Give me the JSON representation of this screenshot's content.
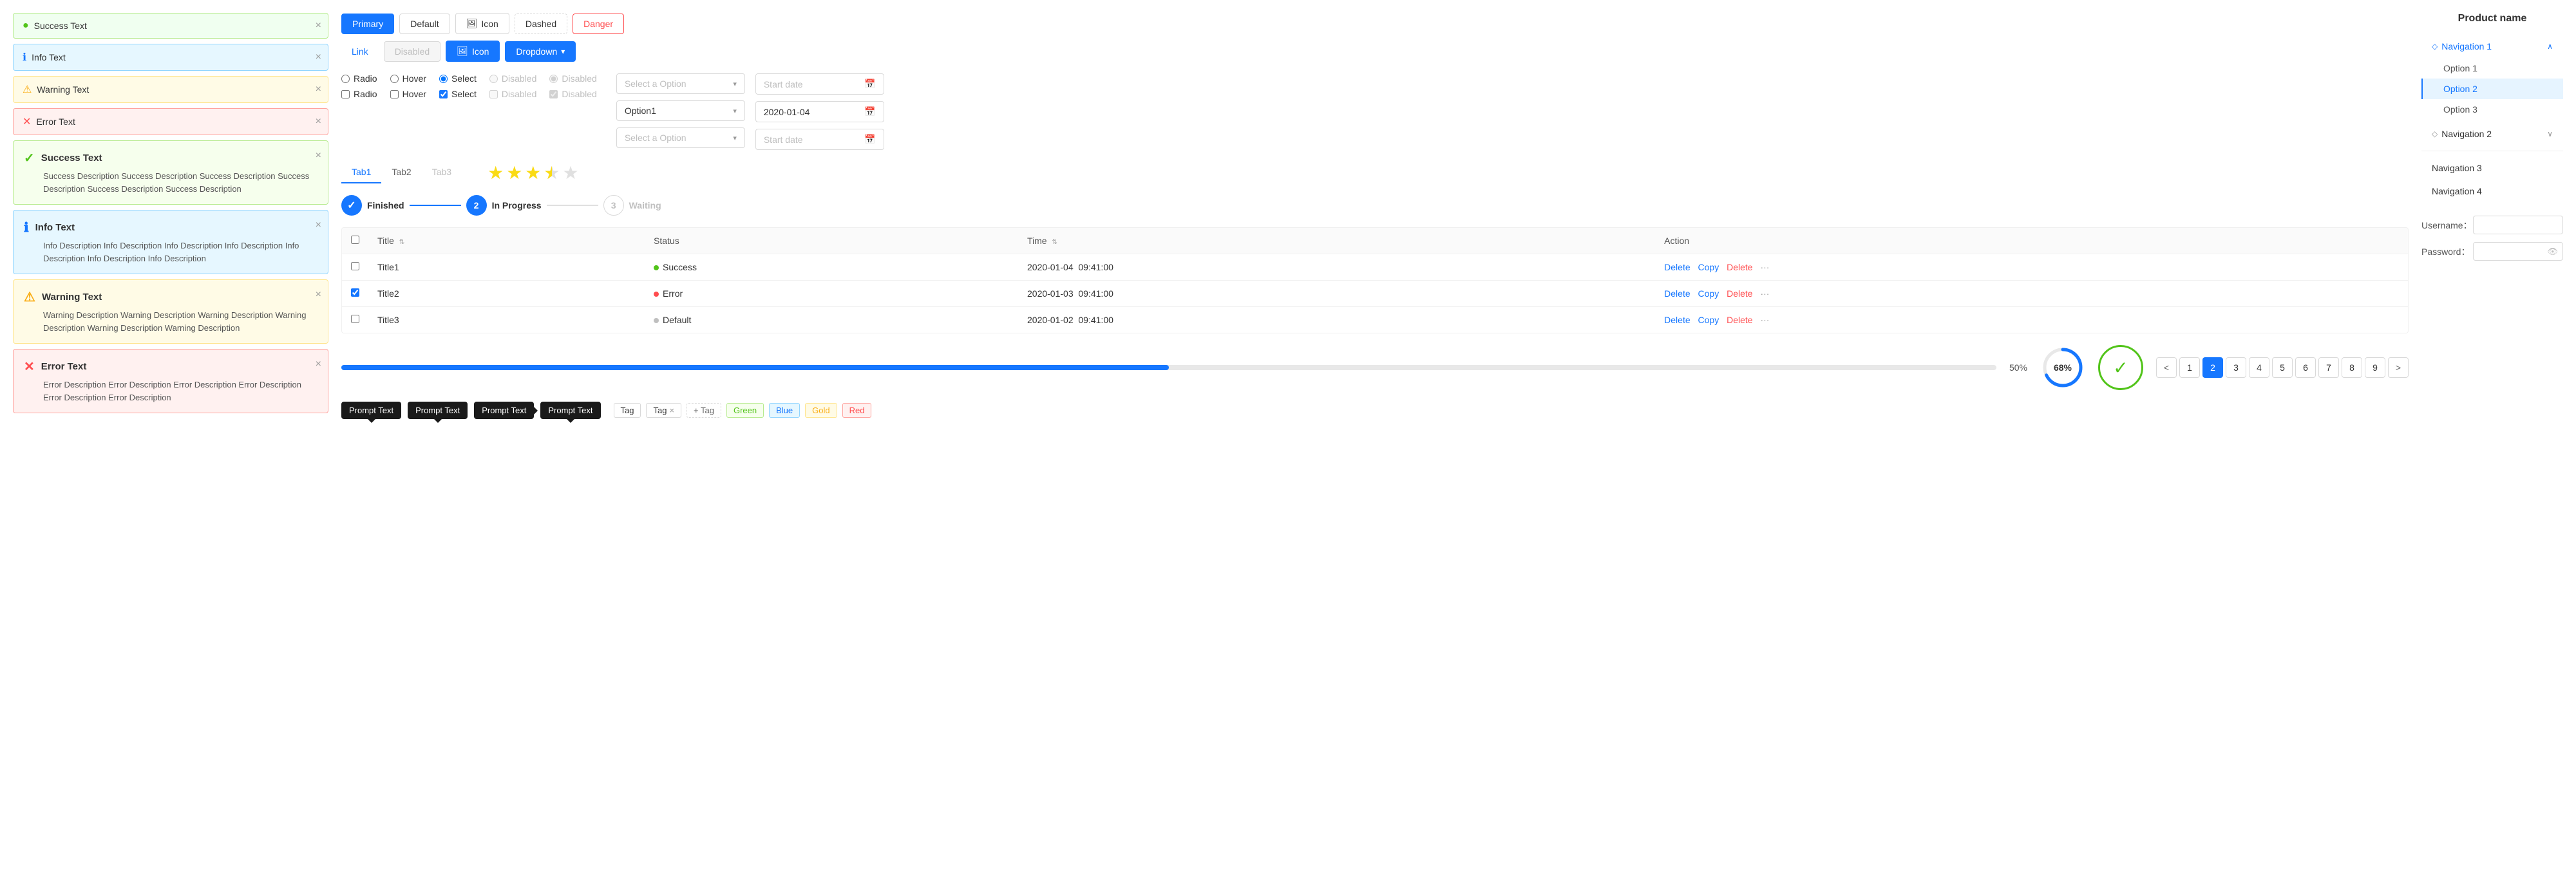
{
  "leftPanel": {
    "simpleAlerts": [
      {
        "type": "success",
        "icon": "●",
        "text": "Success Text",
        "iconColor": "#52c41a"
      },
      {
        "type": "info",
        "icon": "ℹ",
        "text": "Info Text",
        "iconColor": "#1677ff"
      },
      {
        "type": "warning",
        "icon": "⚠",
        "text": "Warning Text",
        "iconColor": "#faad14"
      },
      {
        "type": "error",
        "icon": "✕",
        "text": "Error Text",
        "iconColor": "#ff4d4f"
      }
    ],
    "complexAlerts": [
      {
        "type": "success",
        "icon": "✓",
        "title": "Success Text",
        "desc": "Success Description Success Description Success Description Success Description Success Description Success Description",
        "iconColor": "#52c41a"
      },
      {
        "type": "info",
        "icon": "ℹ",
        "title": "Info Text",
        "desc": "Info Description Info Description Info Description Info Description Info Description Info Description Info Description",
        "iconColor": "#1677ff"
      },
      {
        "type": "warning",
        "icon": "⚠",
        "title": "Warning Text",
        "desc": "Warning Description Warning Description Warning Description Warning Description Warning Description Warning Description",
        "iconColor": "#faad14"
      },
      {
        "type": "error",
        "icon": "✕",
        "title": "Error Text",
        "desc": "Error Description Error Description Error Description Error Description Error Description Error Description",
        "iconColor": "#ff4d4f"
      }
    ]
  },
  "buttons": {
    "row1": [
      {
        "label": "Primary",
        "style": "primary"
      },
      {
        "label": "Default",
        "style": "default"
      },
      {
        "label": "Icon",
        "style": "icon",
        "hasIcon": true
      },
      {
        "label": "Dashed",
        "style": "dashed"
      },
      {
        "label": "Danger",
        "style": "danger"
      }
    ],
    "row2": [
      {
        "label": "Link",
        "style": "link"
      },
      {
        "label": "Disabled",
        "style": "disabled"
      },
      {
        "label": "Icon",
        "style": "icon-blue",
        "hasIcon": true
      },
      {
        "label": "Dropdown",
        "style": "dropdown",
        "hasArrow": true
      }
    ]
  },
  "controls": {
    "row1": [
      {
        "type": "radio",
        "label": "Radio",
        "checked": false
      },
      {
        "type": "radio",
        "label": "Hover",
        "checked": false
      },
      {
        "type": "radio",
        "label": "Select",
        "checked": true
      },
      {
        "type": "radio",
        "label": "Disabled",
        "checked": false,
        "disabled": true
      },
      {
        "type": "radio",
        "label": "Disabled",
        "checked": true,
        "disabled": true
      }
    ],
    "row2": [
      {
        "type": "checkbox",
        "label": "Radio",
        "checked": false
      },
      {
        "type": "checkbox",
        "label": "Hover",
        "checked": false
      },
      {
        "type": "checkbox",
        "label": "Select",
        "checked": true
      },
      {
        "type": "checkbox",
        "label": "Disabled",
        "checked": false,
        "disabled": true
      },
      {
        "type": "checkbox",
        "label": "Disabled",
        "checked": true,
        "disabled": true
      }
    ]
  },
  "tabs": {
    "items": [
      {
        "label": "Tab1",
        "active": true
      },
      {
        "label": "Tab2",
        "active": false
      },
      {
        "label": "Tab3",
        "active": false,
        "disabled": true
      }
    ]
  },
  "stars": {
    "filled": 3,
    "half": true,
    "total": 5
  },
  "steps": [
    {
      "label": "Finished",
      "state": "finished",
      "icon": "✓"
    },
    {
      "num": "2",
      "label": "In Progress",
      "state": "in-progress"
    },
    {
      "num": "3",
      "label": "Waiting",
      "state": "waiting"
    }
  ],
  "table": {
    "columns": [
      "",
      "Title",
      "Status",
      "Time",
      "Action"
    ],
    "rows": [
      {
        "id": "1",
        "title": "Title1",
        "status": "Success",
        "statusType": "success",
        "time": "2020-01-04  09:41:00",
        "checked": false
      },
      {
        "id": "2",
        "title": "Title2",
        "status": "Error",
        "statusType": "error",
        "time": "2020-01-03  09:41:00",
        "checked": true
      },
      {
        "id": "3",
        "title": "Title3",
        "status": "Default",
        "statusType": "default",
        "time": "2020-01-02  09:41:00",
        "checked": false
      }
    ],
    "actions": [
      "Delete",
      "Copy",
      "Delete",
      "···"
    ]
  },
  "progress": {
    "percent": 50,
    "label": "50%",
    "circlePercent": 68,
    "circleLabel": "68%"
  },
  "tooltips": [
    {
      "text": "Prompt Text",
      "arrowDir": "up"
    },
    {
      "text": "Prompt Text",
      "arrowDir": "up"
    },
    {
      "text": "Prompt Text",
      "arrowDir": "right"
    },
    {
      "text": "Prompt Text",
      "arrowDir": "up"
    }
  ],
  "tags": [
    {
      "label": "Tag",
      "closable": false
    },
    {
      "label": "Tag",
      "closable": true
    },
    {
      "label": "+ Tag",
      "type": "add"
    },
    {
      "label": "Green",
      "type": "green"
    },
    {
      "label": "Blue",
      "type": "blue"
    },
    {
      "label": "Gold",
      "type": "gold"
    },
    {
      "label": "Red",
      "type": "red"
    }
  ],
  "selects": [
    {
      "placeholder": "Select a Option",
      "value": null
    },
    {
      "placeholder": "Select a Option",
      "value": "Option1"
    },
    {
      "placeholder": "Select a Option",
      "value": null
    }
  ],
  "dates": [
    {
      "placeholder": "Start date",
      "value": null
    },
    {
      "placeholder": "",
      "value": "2020-01-04"
    },
    {
      "placeholder": "Start date",
      "value": null
    }
  ],
  "pagination": {
    "prev": "<",
    "next": ">",
    "pages": [
      "1",
      "2",
      "3",
      "4",
      "5",
      "6",
      "7",
      "8",
      "9"
    ],
    "active": "2"
  },
  "rightPanel": {
    "productName": "Product name",
    "navItems": [
      {
        "label": "Navigation 1",
        "icon": "◇",
        "expanded": true,
        "subItems": [
          {
            "label": "Option 1"
          },
          {
            "label": "Option 2",
            "selected": true
          },
          {
            "label": "Option 3"
          }
        ]
      },
      {
        "label": "Navigation 2",
        "icon": "◇",
        "expanded": false
      },
      {
        "label": "Navigation 3"
      },
      {
        "label": "Navigation 4"
      }
    ],
    "form": {
      "usernameLabel": "Username：",
      "passwordLabel": "Password："
    }
  },
  "selectOptions": {
    "topRight": {
      "row1": "Select Option",
      "row2": "Select Option"
    }
  }
}
